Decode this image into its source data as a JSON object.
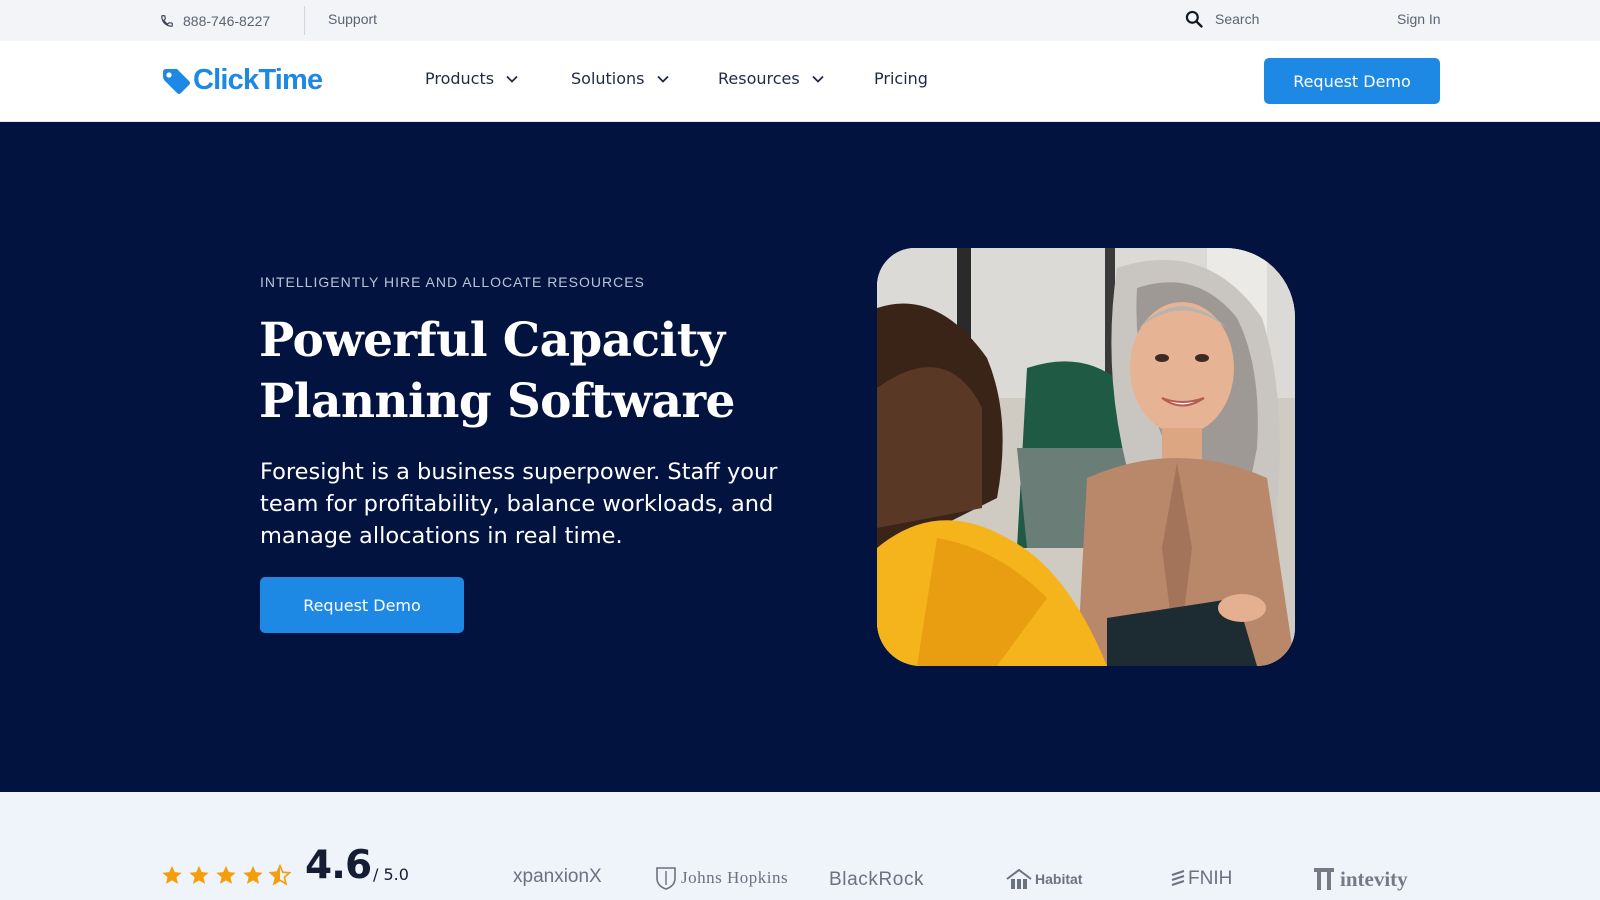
{
  "utility_bar": {
    "phone": "888-746-8227",
    "support": "Support",
    "search_label": "Search",
    "sign_in": "Sign In"
  },
  "nav": {
    "logo_text": "ClickTime",
    "items": [
      {
        "label": "Products",
        "icon": "chevron-down-icon"
      },
      {
        "label": "Solutions",
        "icon": "chevron-down-icon"
      },
      {
        "label": "Resources",
        "icon": "chevron-down-icon"
      },
      {
        "label": "Pricing"
      }
    ],
    "cta": "Request Demo"
  },
  "hero": {
    "eyebrow": "INTELLIGENTLY HIRE AND ALLOCATE RESOURCES",
    "headline": "Powerful Capacity Planning Software",
    "subcopy": "Foresight is a business superpower. Staff your team for profitability, balance workloads, and manage allocations in real time.",
    "cta": "Request Demo",
    "image": "photo of a smiling woman with long gray hair holding a clipboard, facing a person in a yellow top"
  },
  "proof": {
    "stars": 4.5,
    "rating": "4.6",
    "rating_of": "/ 5.0",
    "clients": [
      "xpanxionX",
      "Johns Hopkins",
      "BlackRock",
      "Habitat",
      "FNIH",
      "intevity"
    ]
  },
  "colors": {
    "brand_blue": "#1e88e5",
    "hero_navy": "#03133f",
    "star_orange": "#f59e0b",
    "utility_bg": "#f2f4f8",
    "proof_bg": "#eff3fa"
  }
}
